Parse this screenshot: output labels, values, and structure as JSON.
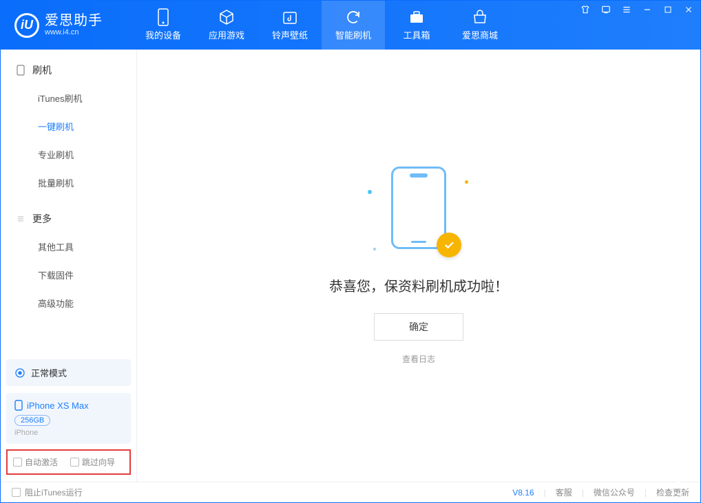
{
  "logo": {
    "cn": "爱思助手",
    "url": "www.i4.cn"
  },
  "tabs": {
    "device": "我的设备",
    "apps": "应用游戏",
    "ring": "铃声壁纸",
    "flash": "智能刷机",
    "toolbox": "工具箱",
    "store": "爱思商城"
  },
  "sidebar": {
    "section1": "刷机",
    "items1": {
      "itunes": "iTunes刷机",
      "oneclick": "一键刷机",
      "pro": "专业刷机",
      "batch": "批量刷机"
    },
    "section2": "更多",
    "items2": {
      "other": "其他工具",
      "firmware": "下载固件",
      "advanced": "高级功能"
    }
  },
  "status": {
    "label": "正常模式"
  },
  "device": {
    "name": "iPhone XS Max",
    "capacity": "256GB",
    "type": "iPhone"
  },
  "options": {
    "autoactivate": "自动激活",
    "skipguide": "跳过向导"
  },
  "main": {
    "message": "恭喜您，保资料刷机成功啦！",
    "ok": "确定",
    "viewlog": "查看日志"
  },
  "footer": {
    "blockitunes": "阻止iTunes运行",
    "version": "V8.16",
    "support": "客服",
    "wechat": "微信公众号",
    "update": "检查更新"
  }
}
